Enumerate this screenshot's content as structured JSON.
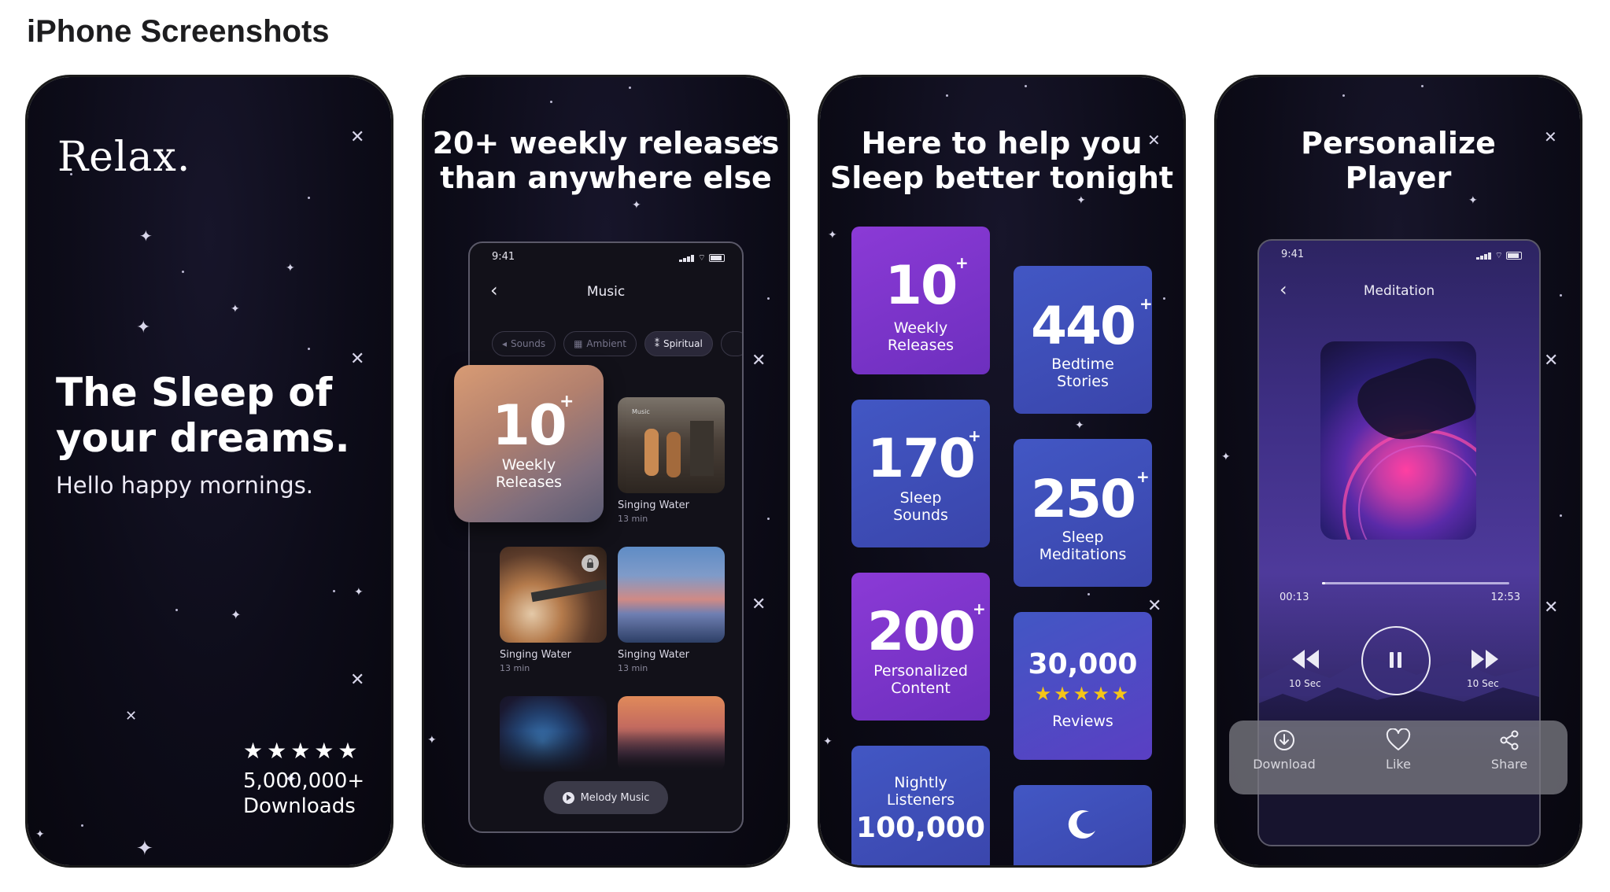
{
  "section": {
    "title": "iPhone Screenshots"
  },
  "card1": {
    "logo": "Relax.",
    "headline_line1": "The Sleep of",
    "headline_line2": "your dreams.",
    "subtitle": "Hello happy mornings.",
    "rating_stars": "★★★★★",
    "downloads_count": "5,000,000+",
    "downloads_label": "Downloads"
  },
  "card2": {
    "heading_line1": "20+ weekly releases",
    "heading_line2": "than anywhere else",
    "time": "9:41",
    "screen_title": "Music",
    "chips": [
      {
        "label": "Sounds",
        "active": false
      },
      {
        "label": "Ambient",
        "active": false
      },
      {
        "label": "Spiritual",
        "active": true
      }
    ],
    "featured": {
      "number": "10",
      "plus": "+",
      "label_line1": "Weekly",
      "label_line2": "Releases"
    },
    "tracks": [
      {
        "tag": "Music",
        "title": "Singing Water",
        "duration": "13 min"
      },
      {
        "title": "Singing Water",
        "duration": "13 min"
      },
      {
        "title": "Singing Water",
        "duration": "13 min"
      }
    ],
    "player_pill": "Melody Music"
  },
  "card3": {
    "heading_line1": "Here to help you",
    "heading_line2": "Sleep better tonight",
    "stats": [
      {
        "number": "10",
        "plus": "+",
        "label_line1": "Weekly",
        "label_line2": "Releases"
      },
      {
        "number": "440",
        "plus": "+",
        "label_line1": "Bedtime",
        "label_line2": "Stories"
      },
      {
        "number": "170",
        "plus": "+",
        "label_line1": "Sleep",
        "label_line2": "Sounds"
      },
      {
        "number": "250",
        "plus": "+",
        "label_line1": "Sleep",
        "label_line2": "Meditations"
      },
      {
        "number": "200",
        "plus": "+",
        "label_line1": "Personalized",
        "label_line2": "Content"
      },
      {
        "number": "30,000",
        "stars": "★★★★★",
        "label": "Reviews"
      },
      {
        "label_line1": "Nightly",
        "label_line2": "Listeners",
        "number": "100,000"
      },
      {
        "icon": "moon-icon"
      }
    ]
  },
  "card4": {
    "heading_line1": "Personalize",
    "heading_line2": "Player",
    "time": "9:41",
    "screen_title": "Meditation",
    "elapsed": "00:13",
    "total": "12:53",
    "progress_fraction": 0.018,
    "rewind_label": "10 Sec",
    "forward_label": "10 Sec",
    "actions": {
      "download": "Download",
      "like": "Like",
      "share": "Share"
    }
  },
  "colors": {
    "card_bg": "#0d0c19",
    "stat_purple": "#7a37c9",
    "stat_blue": "#3f4fb5",
    "text": "#ffffff"
  }
}
